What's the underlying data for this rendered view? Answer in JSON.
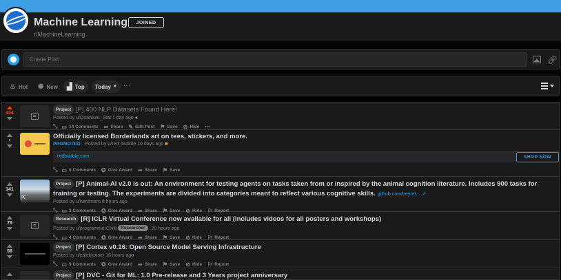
{
  "header": {
    "subreddit_title": "Machine Learning",
    "subreddit_name": "r/MachineLearning",
    "joined_label": "JOINED"
  },
  "create_post": {
    "placeholder": "Create Post"
  },
  "sort_bar": {
    "items": [
      {
        "label": "Hot",
        "icon": "flame-icon"
      },
      {
        "label": "New",
        "icon": "sparkle-icon"
      },
      {
        "label": "Top",
        "icon": "bar-chart-icon",
        "active": true
      }
    ],
    "time_filter": "Today",
    "more": "···"
  },
  "posts": [
    {
      "score": "424",
      "upvoted": true,
      "flair": "Project",
      "title": "[P] 400 NLP Datasets Found Here!",
      "meta": "Posted by u/Quantum_Stat 1 day ago",
      "actions": [
        "14 Comments",
        "Share",
        "Edit Post",
        "Save",
        "Hide",
        "•••"
      ]
    },
    {
      "score": "•",
      "title": "Officially licensed Borderlands art on tees, stickers, and more.",
      "promoted": "PROMOTED",
      "meta": "· Posted by u/red_bubble 10 days ago",
      "ad_domain": "redbubble.com",
      "shop_label": "SHOP NOW",
      "actions": [
        "0 Comments",
        "Give Award",
        "Share",
        "Save"
      ]
    },
    {
      "score": "141",
      "flair": "Project",
      "title": "[P] Animal-AI v2.0 is out: An environment for testing agents on tasks taken from or inspired by the animal cognition literature. Includes 900 tasks for training or testing. The experiments are divided into categories meant to reflect various cognitive skills.",
      "domain": "github.com/beyret...",
      "meta": "Posted by u/hardmaru 8 hours ago",
      "actions": [
        "3 Comments",
        "Give Award",
        "Share",
        "Save",
        "Hide",
        "Report"
      ]
    },
    {
      "score": "79",
      "flair": "Research",
      "title": "[R] ICLR Virtual Conference now available for all (includes videos for all posters and workshops)",
      "meta": "Posted by u/programmerChilli",
      "user_flair": "Researcher",
      "meta_time": "20 hours ago",
      "actions": [
        "4 Comments",
        "Give Award",
        "Share",
        "Save",
        "Hide",
        "Report"
      ]
    },
    {
      "score": "58",
      "flair": "Project",
      "title": "[P] Cortex v0.16: Open Source Model Serving Infrastructure",
      "meta": "Posted by u/calebkaiser 16 hours ago",
      "actions": [
        "9 Comments",
        "Give Award",
        "Share",
        "Save",
        "Hide",
        "Report"
      ]
    },
    {
      "flair": "Project",
      "title": "[P] DVC - Git for ML: 1.0 Pre-release and 3 Years project anniversary"
    }
  ]
}
